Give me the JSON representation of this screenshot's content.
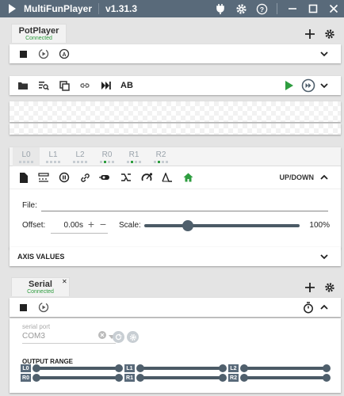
{
  "titlebar": {
    "app_name": "MultiFunPlayer",
    "version": "v1.31.3",
    "icons": [
      "play-icon",
      "plugin-icon",
      "gear-icon",
      "help-icon",
      "minimize-icon",
      "maximize-icon",
      "close-icon"
    ]
  },
  "media_source": {
    "tab_name": "PotPlayer",
    "tab_status": "Connected",
    "controls": [
      "stop-icon",
      "autoplay-icon",
      "auto-connect-icon"
    ]
  },
  "script_toolbar": {
    "ab_label": "AB",
    "icons": [
      "open-folder-icon",
      "search-library-icon",
      "copy-icon",
      "link-icon",
      "skip-icon",
      "play-icon",
      "playlist-play-icon",
      "chevron-down-icon"
    ]
  },
  "axes": {
    "tabs": [
      {
        "label": "L0",
        "dots": [
          0,
          0,
          0,
          0
        ]
      },
      {
        "label": "L1",
        "dots": [
          0,
          0,
          0,
          0
        ]
      },
      {
        "label": "L2",
        "dots": [
          0,
          0,
          0,
          0
        ]
      },
      {
        "label": "R0",
        "dots": [
          0,
          1,
          0,
          0
        ]
      },
      {
        "label": "R1",
        "dots": [
          0,
          1,
          0,
          0
        ]
      },
      {
        "label": "R2",
        "dots": [
          0,
          1,
          0,
          0
        ]
      }
    ],
    "motion_label": "UP/DOWN",
    "file_label": "File:",
    "file_value": "",
    "offset_label": "Offset:",
    "offset_value": "0.00s",
    "offset_plus": "+",
    "offset_minus": "−",
    "scale_label": "Scale:",
    "scale_value": "100%",
    "scale_fraction": 0.25
  },
  "axis_values": {
    "label": "AXIS VALUES"
  },
  "output": {
    "tab_name": "Serial",
    "tab_status": "Connected",
    "close_glyph": "✕",
    "serial_port_label": "serial port",
    "serial_port_value": "COM3",
    "output_range_label": "OUTPUT RANGE",
    "ranges": [
      {
        "axis": "L0",
        "min": 0,
        "max": 100
      },
      {
        "axis": "R0",
        "min": 0,
        "max": 100
      },
      {
        "axis": "L1",
        "min": 0,
        "max": 100
      },
      {
        "axis": "R1",
        "min": 0,
        "max": 100
      },
      {
        "axis": "L2",
        "min": 0,
        "max": 100
      },
      {
        "axis": "R2",
        "min": 0,
        "max": 100
      }
    ]
  },
  "colors": {
    "titlebar": "#596a7a",
    "accent_green": "#2e9d3f",
    "slider": "#4b5a66"
  }
}
